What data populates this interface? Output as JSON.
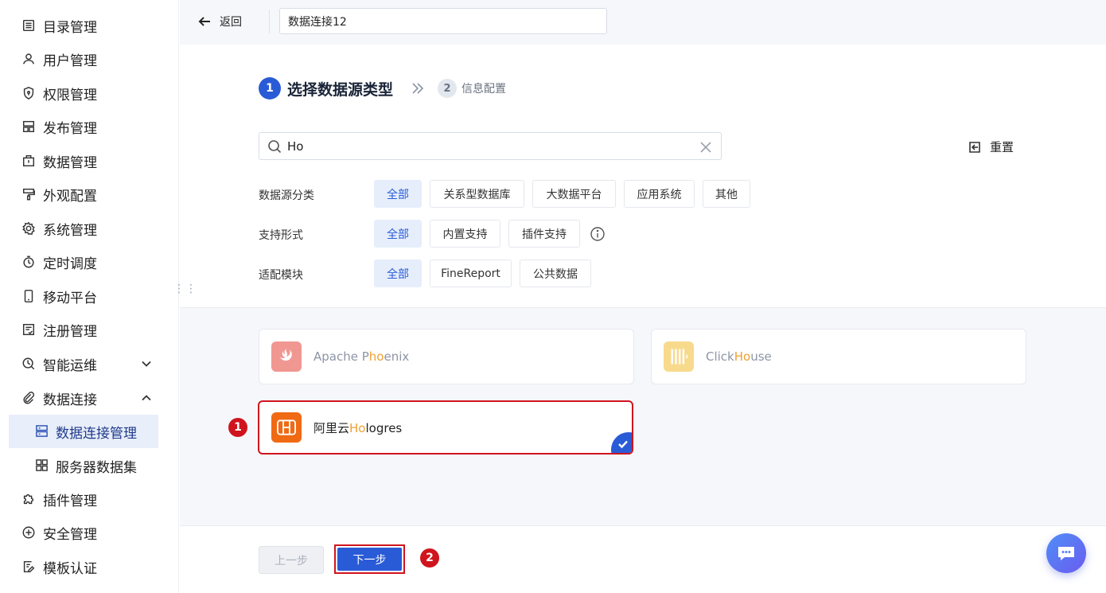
{
  "sidebar": {
    "items": [
      {
        "label": "目录管理",
        "icon": "catalog-icon"
      },
      {
        "label": "用户管理",
        "icon": "user-icon"
      },
      {
        "label": "权限管理",
        "icon": "shield-icon"
      },
      {
        "label": "发布管理",
        "icon": "publish-icon"
      },
      {
        "label": "数据管理",
        "icon": "data-icon"
      },
      {
        "label": "外观配置",
        "icon": "brush-icon"
      },
      {
        "label": "系统管理",
        "icon": "gear-icon"
      },
      {
        "label": "定时调度",
        "icon": "timer-icon"
      },
      {
        "label": "移动平台",
        "icon": "mobile-icon"
      },
      {
        "label": "注册管理",
        "icon": "register-icon"
      },
      {
        "label": "智能运维",
        "icon": "ops-icon"
      },
      {
        "label": "数据连接",
        "icon": "paperclip-icon"
      },
      {
        "label": "插件管理",
        "icon": "puzzle-icon"
      },
      {
        "label": "安全管理",
        "icon": "security-icon"
      },
      {
        "label": "模板认证",
        "icon": "template-icon"
      }
    ],
    "sub_items": [
      {
        "label": "数据连接管理"
      },
      {
        "label": "服务器数据集"
      }
    ]
  },
  "topbar": {
    "back_label": "返回",
    "name_value": "数据连接12"
  },
  "stepper": {
    "step1_num": "1",
    "step1_label": "选择数据源类型",
    "step2_num": "2",
    "step2_label": "信息配置"
  },
  "search": {
    "value": "Ho",
    "reset_label": "重置"
  },
  "filters": {
    "category_label": "数据源分类",
    "category_options": [
      "全部",
      "关系型数据库",
      "大数据平台",
      "应用系统",
      "其他"
    ],
    "support_label": "支持形式",
    "support_options": [
      "全部",
      "内置支持",
      "插件支持"
    ],
    "module_label": "适配模块",
    "module_options": [
      "全部",
      "FineReport",
      "公共数据"
    ]
  },
  "cards": [
    {
      "pre": "Apache P",
      "hl": "ho",
      "post": "enix",
      "color": "#e8534a"
    },
    {
      "pre": "Click",
      "hl": "Ho",
      "post": "use",
      "color": "#f5c242"
    },
    {
      "pre": "阿里云",
      "hl": "Ho",
      "post": "logres",
      "color": "#f06a14"
    }
  ],
  "annotations": {
    "badge1": "1",
    "badge2": "2"
  },
  "footer": {
    "prev_label": "上一步",
    "next_label": "下一步"
  },
  "colors": {
    "accent": "#2a5bd7",
    "highlight": "#f0a030",
    "annotation_red": "#d0141d"
  }
}
